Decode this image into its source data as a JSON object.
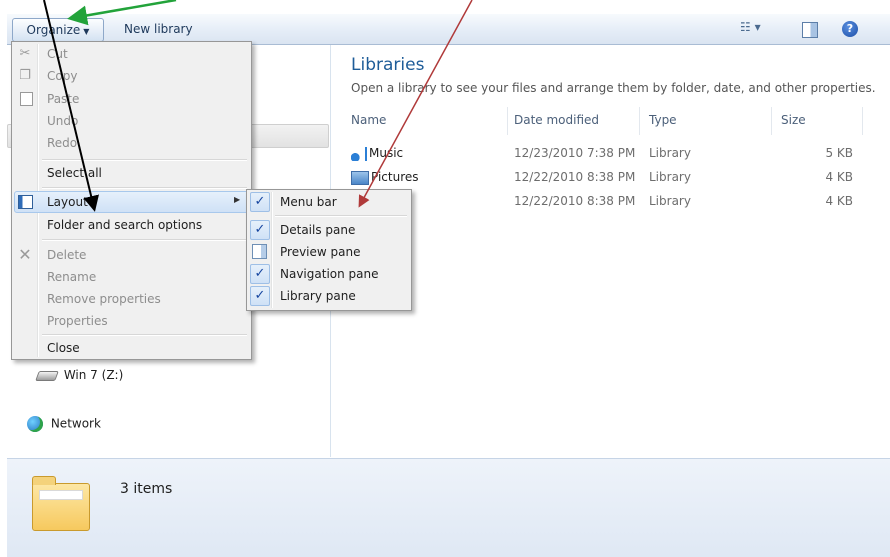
{
  "toolbar": {
    "organize_label": "Organize",
    "new_library_label": "New library",
    "view_icon": "views-icon",
    "pane_icon": "preview-pane-icon",
    "help_label": "?"
  },
  "nav": {
    "items": [
      {
        "label": "Win 7 (Z:)",
        "icon": "drive-icon"
      },
      {
        "label": "Network",
        "icon": "network-icon"
      }
    ]
  },
  "main": {
    "title": "Libraries",
    "description": "Open a library to see your files and arrange them by folder, date, and other properties.",
    "columns": [
      "Name",
      "Date modified",
      "Type",
      "Size"
    ],
    "rows": [
      {
        "name": "Music",
        "date": "12/23/2010 7:38 PM",
        "type": "Library",
        "size": "5 KB",
        "icon": "music-icon"
      },
      {
        "name": "Pictures",
        "date": "12/22/2010 8:38 PM",
        "type": "Library",
        "size": "4 KB",
        "icon": "pictures-icon"
      },
      {
        "name": "",
        "date": "12/22/2010 8:38 PM",
        "type": "Library",
        "size": "4 KB",
        "icon": ""
      }
    ]
  },
  "details": {
    "count": "3 items"
  },
  "organize_menu": {
    "cut": "Cut",
    "copy": "Copy",
    "paste": "Paste",
    "undo": "Undo",
    "redo": "Redo",
    "select_all": "Select all",
    "layout": "Layout",
    "folder_options": "Folder and search options",
    "delete": "Delete",
    "rename": "Rename",
    "remove_properties": "Remove properties",
    "properties": "Properties",
    "close": "Close"
  },
  "layout_submenu": {
    "items": [
      {
        "label": "Menu bar",
        "checked": true
      },
      {
        "label": "Details pane",
        "checked": true
      },
      {
        "label": "Preview pane",
        "checked": false
      },
      {
        "label": "Navigation pane",
        "checked": true
      },
      {
        "label": "Library pane",
        "checked": true
      }
    ]
  },
  "annotation_colors": {
    "green_arrow": "#22a33a",
    "black_arrow": "#000000",
    "red_arrow": "#b03a3a"
  }
}
